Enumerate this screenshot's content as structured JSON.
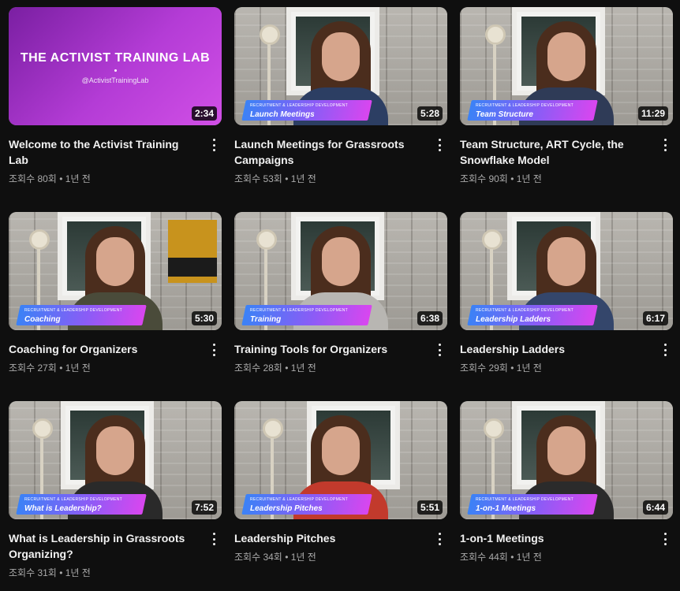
{
  "videos": [
    {
      "title": "Welcome to the Activist Training Lab",
      "views": "조회수 80회",
      "age": "1년 전",
      "duration": "2:34",
      "thumb_type": "title-card",
      "card_title": "THE ACTIVIST TRAINING LAB",
      "card_handle": "@ActivistTrainingLab"
    },
    {
      "title": "Launch Meetings for Grassroots Campaigns",
      "views": "조회수 53회",
      "age": "1년 전",
      "duration": "5:28",
      "banner_small": "RECRUITMENT & LEADERSHIP DEVELOPMENT",
      "banner_title": "Launch Meetings",
      "shirt": "#2c3e63"
    },
    {
      "title": "Team Structure, ART Cycle, the Snowflake Model",
      "views": "조회수 90회",
      "age": "1년 전",
      "duration": "11:29",
      "banner_small": "RECRUITMENT & LEADERSHIP DEVELOPMENT",
      "banner_title": "Team Structure",
      "shirt": "#2f3b57"
    },
    {
      "title": "Coaching for Organizers",
      "views": "조회수 27회",
      "age": "1년 전",
      "duration": "5:30",
      "banner_small": "RECRUITMENT & LEADERSHIP DEVELOPMENT",
      "banner_title": "Coaching",
      "shirt": "#4a4b3a",
      "poster": true
    },
    {
      "title": "Training Tools for Organizers",
      "views": "조회수 28회",
      "age": "1년 전",
      "duration": "6:38",
      "banner_small": "RECRUITMENT & LEADERSHIP DEVELOPMENT",
      "banner_title": "Training",
      "shirt": "#b8b6b2"
    },
    {
      "title": "Leadership Ladders",
      "views": "조회수 29회",
      "age": "1년 전",
      "duration": "6:17",
      "banner_small": "RECRUITMENT & LEADERSHIP DEVELOPMENT",
      "banner_title": "Leadership Ladders",
      "shirt": "#34466b"
    },
    {
      "title": "What is Leadership in Grassroots Organizing?",
      "views": "조회수 31회",
      "age": "1년 전",
      "duration": "7:52",
      "banner_small": "RECRUITMENT & LEADERSHIP DEVELOPMENT",
      "banner_title": "What is Leadership?",
      "shirt": "#2a2a2a"
    },
    {
      "title": "Leadership Pitches",
      "views": "조회수 34회",
      "age": "1년 전",
      "duration": "5:51",
      "banner_small": "RECRUITMENT & LEADERSHIP DEVELOPMENT",
      "banner_title": "Leadership Pitches",
      "shirt": "#c23a2c"
    },
    {
      "title": "1-on-1 Meetings",
      "views": "조회수 44회",
      "age": "1년 전",
      "duration": "6:44",
      "banner_small": "RECRUITMENT & LEADERSHIP DEVELOPMENT",
      "banner_title": "1-on-1 Meetings",
      "shirt": "#2b2b2b"
    }
  ],
  "separator": "•",
  "icons": {
    "more": "more-vert-icon"
  }
}
